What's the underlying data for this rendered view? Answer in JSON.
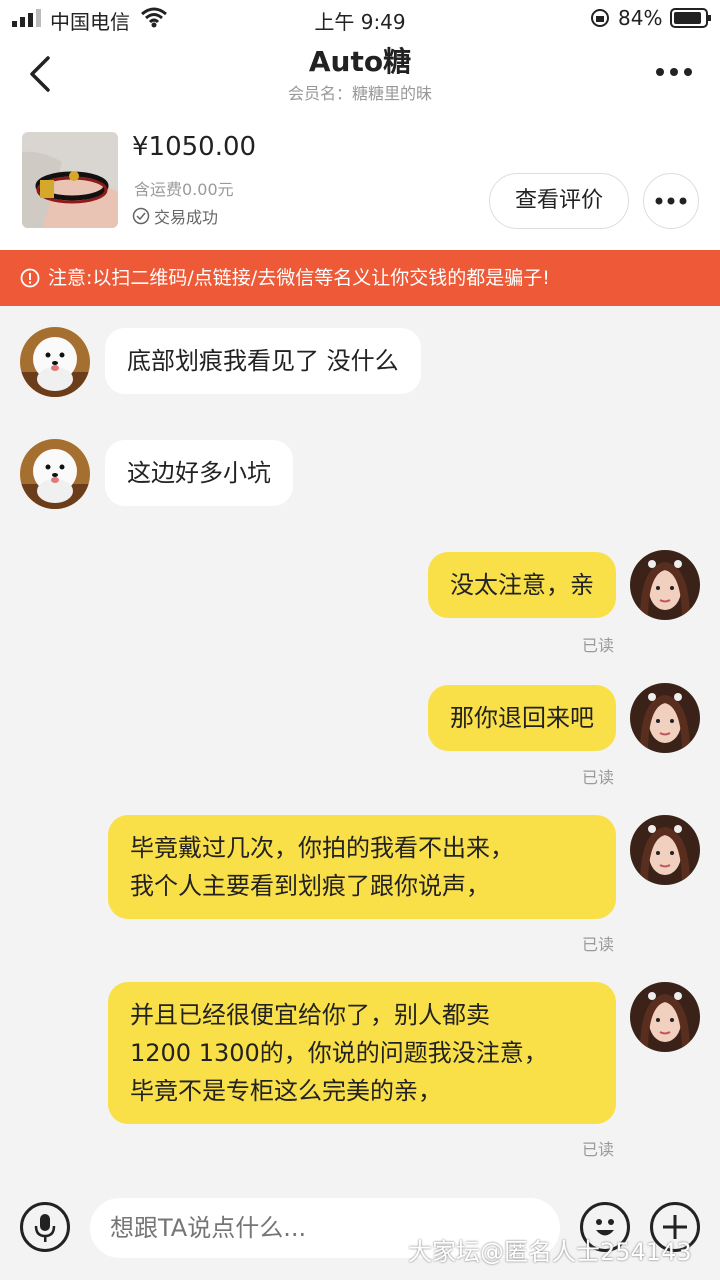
{
  "status_bar": {
    "carrier": "中国电信",
    "time": "上午 9:49",
    "battery": "84%"
  },
  "header": {
    "title": "Auto糖",
    "subtitle": "会员名：糖糖里的昧"
  },
  "product": {
    "price": "¥1050.00",
    "shipping": "含运费0.00元",
    "status": "交易成功",
    "review_button": "查看评价"
  },
  "warning": {
    "text": "注意:以扫二维码/点链接/去微信等名义让你交钱的都是骗子!"
  },
  "messages": [
    {
      "side": "in",
      "text": "底部划痕我看见了 没什么"
    },
    {
      "side": "in",
      "text": "这边好多小坑"
    },
    {
      "side": "out",
      "text": "没太注意，亲",
      "status": "已读"
    },
    {
      "side": "out",
      "text": "那你退回来吧",
      "status": "已读"
    },
    {
      "side": "out",
      "lines": [
        "毕竟戴过几次，你拍的我看不出来，",
        "我个人主要看到划痕了跟你说声，"
      ],
      "status": "已读"
    },
    {
      "side": "out",
      "lines": [
        "并且已经很便宜给你了，别人都卖",
        "1200 1300的，你说的问题我没注意，",
        "毕竟不是专柜这么完美的亲，"
      ],
      "status": "已读"
    }
  ],
  "input": {
    "placeholder": "想跟TA说点什么..."
  },
  "watermark": "大家坛@匿名人士254143",
  "colors": {
    "warning_bg": "#ee5a37",
    "outgoing_bubble": "#f9e049",
    "incoming_bubble": "#ffffff"
  }
}
